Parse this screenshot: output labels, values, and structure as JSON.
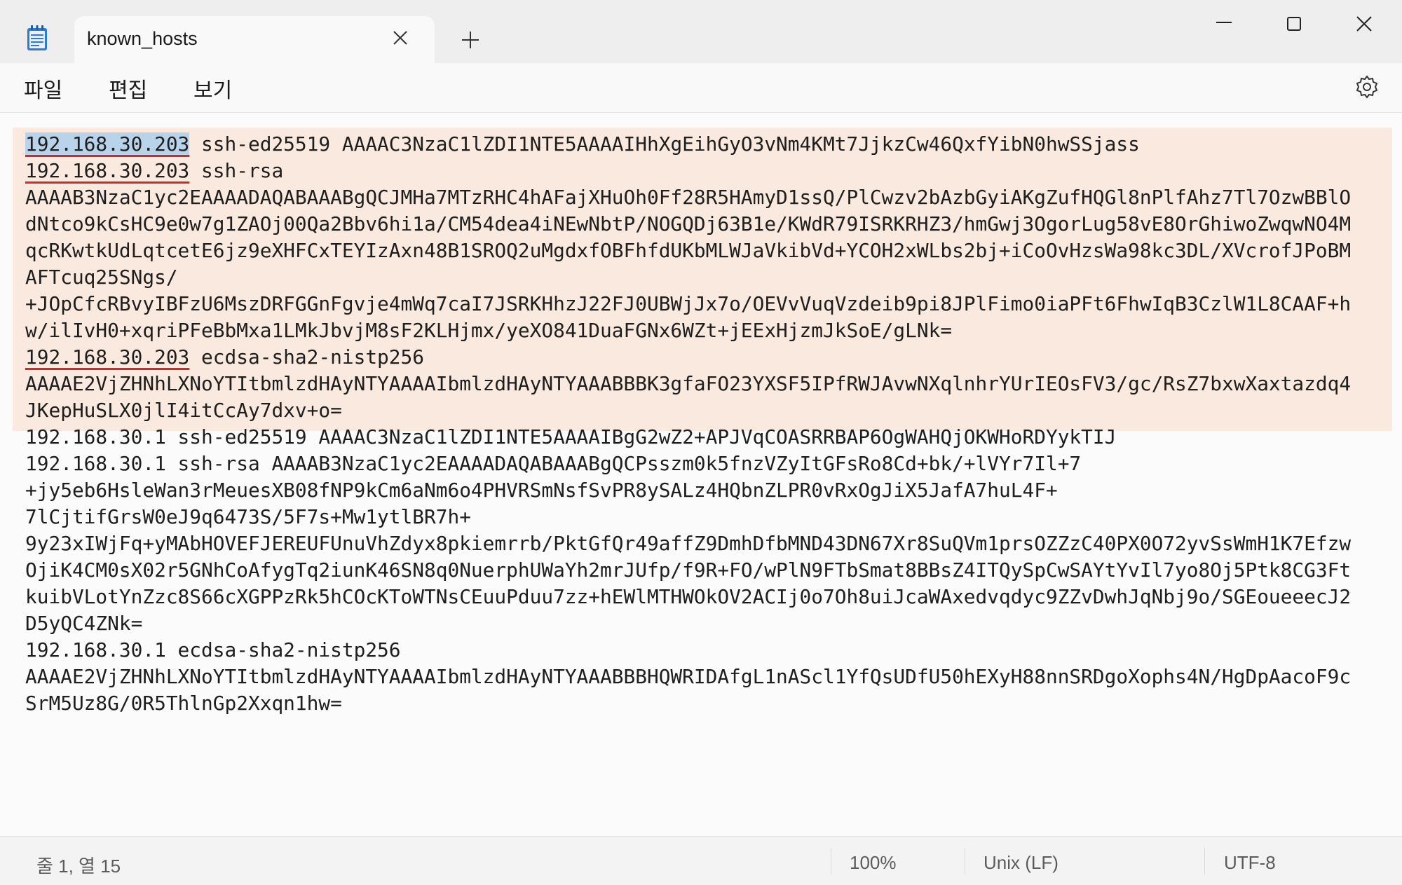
{
  "tab": {
    "title": "known_hosts"
  },
  "menu": [
    "파일",
    "편집",
    "보기"
  ],
  "lines": [
    {
      "ip": "192.168.30.203",
      "rest": " ssh-ed25519 AAAAC3NzaC1lZDI1NTE5AAAAIHhXgEihGyO3vNm4KMt7JjkzCw46QxfYibN0hwSSjass"
    },
    {
      "ip": "192.168.30.203",
      "rest": " ssh-rsa"
    },
    {
      "text": "AAAAB3NzaC1yc2EAAAADAQABAAABgQCJMHa7MTzRHC4hAFajXHuOh0Ff28R5HAmyD1ssQ/PlCwzv2bAzbGyiAKgZufHQGl8nPlfAhz7Tl7OzwBBlO"
    },
    {
      "text": "dNtco9kCsHC9e0w7g1ZAOj00Qa2Bbv6hi1a/CM54dea4iNEwNbtP/NOGQDj63B1e/KWdR79ISRKRHZ3/hmGwj3OgorLug58vE8OrGhiwoZwqwNO4M"
    },
    {
      "text": "qcRKwtkUdLqtcetE6jz9eXHFCxTEYIzAxn48B1SROQ2uMgdxfOBFhfdUKbMLWJaVkibVd+YCOH2xWLbs2bj+iCoOvHzsWa98kc3DL/XVcrofJPoBM"
    },
    {
      "text": "AFTcuq25SNgs/"
    },
    {
      "text": "+JOpCfcRBvyIBFzU6MszDRFGGnFgvje4mWq7caI7JSRKHhzJ22FJ0UBWjJx7o/OEVvVuqVzdeib9pi8JPlFimo0iaPFt6FhwIqB3CzlW1L8CAAF+h"
    },
    {
      "text": "w/ilIvH0+xqriPFeBbMxa1LMkJbvjM8sF2KLHjmx/yeXO841DuaFGNx6WZt+jEExHjzmJkSoE/gLNk="
    },
    {
      "ip": "192.168.30.203",
      "rest": " ecdsa-sha2-nistp256"
    },
    {
      "text": "AAAAE2VjZHNhLXNoYTItbmlzdHAyNTYAAAAIbmlzdHAyNTYAAABBBK3gfaFO23YXSF5IPfRWJAvwNXqlnhrYUrIEOsFV3/gc/RsZ7bxwXaxtazdq4"
    },
    {
      "text": "JKepHuSLX0jlI4itCcAy7dxv+o="
    },
    {
      "text": "192.168.30.1 ssh-ed25519 AAAAC3NzaC1lZDI1NTE5AAAAIBgG2wZ2+APJVqCOASRRBAP6OgWAHQjOKWHoRDYykTIJ"
    },
    {
      "text": "192.168.30.1 ssh-rsa AAAAB3NzaC1yc2EAAAADAQABAAABgQCPsszm0k5fnzVZyItGFsRo8Cd+bk/+lVYr7Il+7"
    },
    {
      "text": "+jy5eb6HsleWan3rMeuesXB08fNP9kCm6aNm6o4PHVRSmNsfSvPR8ySALz4HQbnZLPR0vRxOgJiX5JafA7huL4F+"
    },
    {
      "text": "7lCjtifGrsW0eJ9q6473S/5F7s+Mw1ytlBR7h+"
    },
    {
      "text": "9y23xIWjFq+yMAbHOVEFJEREUFUnuVhZdyx8pkiemrrb/PktGfQr49affZ9DmhDfbMND43DN67Xr8SuQVm1prsOZZzC40PX0O72yvSsWmH1K7Efzw"
    },
    {
      "text": "OjiK4CM0sX02r5GNhCoAfygTq2iunK46SN8q0NuerphUWaYh2mrJUfp/f9R+FO/wPlN9FTbSmat8BBsZ4ITQySpCwSAYtYvIl7yo8Oj5Ptk8CG3Ft"
    },
    {
      "text": "kuibVLotYnZzc8S66cXGPPzRk5hCOcKToWTNsCEuuPduu7zz+hEWlMTHWOkOV2ACIj0o7Oh8uiJcaWAxedvqdyc9ZZvDwhJqNbj9o/SGEoueeecJ2"
    },
    {
      "text": "D5yQC4ZNk="
    },
    {
      "text": "192.168.30.1 ecdsa-sha2-nistp256"
    },
    {
      "text": "AAAAE2VjZHNhLXNoYTItbmlzdHAyNTYAAAAIbmlzdHAyNTYAAABBBHQWRIDAfgL1nAScl1YfQsUDfU50hEXyH88nnSRDgoXophs4N/HgDpAacoF9c"
    },
    {
      "text": "SrM5Uz8G/0R5ThlnGp2Xxqn1hw="
    }
  ],
  "status": {
    "position": "줄 1, 열 15",
    "zoom": "100%",
    "line_ending": "Unix (LF)",
    "encoding": "UTF-8"
  },
  "colors": {
    "highlight_band": "#fae9de",
    "underline": "#d62828",
    "selection": "#b8d3ea"
  }
}
